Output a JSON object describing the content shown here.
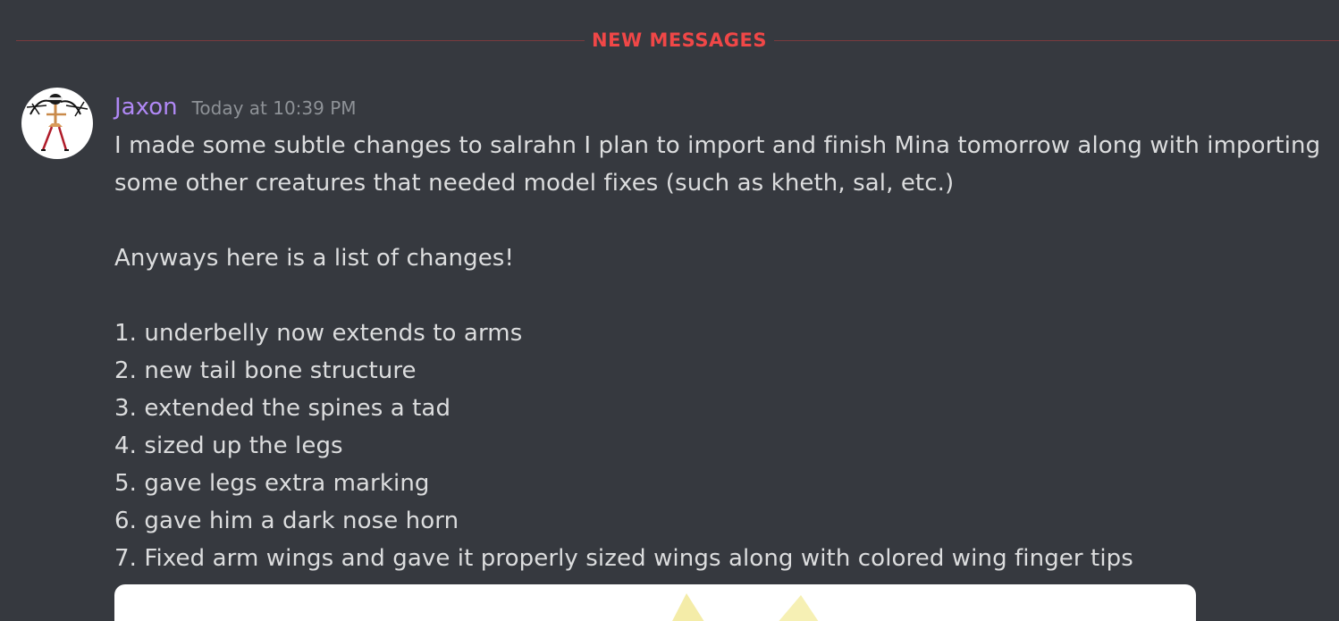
{
  "divider": {
    "label": "NEW MESSAGES",
    "color": "#f04747"
  },
  "message": {
    "author": "Jaxon",
    "author_color": "#b088f5",
    "timestamp": "Today at 10:39 PM",
    "avatar_icon": "stick-figure-avatar-icon",
    "paragraphs": {
      "intro_line_1": "I made some subtle changes to salrahn I plan to import and finish Mina tomorrow along with importing",
      "intro_line_2": "some other creatures that needed model fixes (such as kheth, sal, etc.)",
      "list_intro": "Anyways here is a list of changes!"
    },
    "changes": [
      "1. underbelly now extends to arms",
      "2. new tail bone structure",
      "3. extended the spines a tad",
      "4. sized up the legs",
      "5. gave legs extra marking",
      "6. gave him a dark nose horn",
      "7. Fixed arm wings and gave it properly sized wings along with colored wing finger tips"
    ],
    "attachment_icon": "image-attachment-icon"
  }
}
